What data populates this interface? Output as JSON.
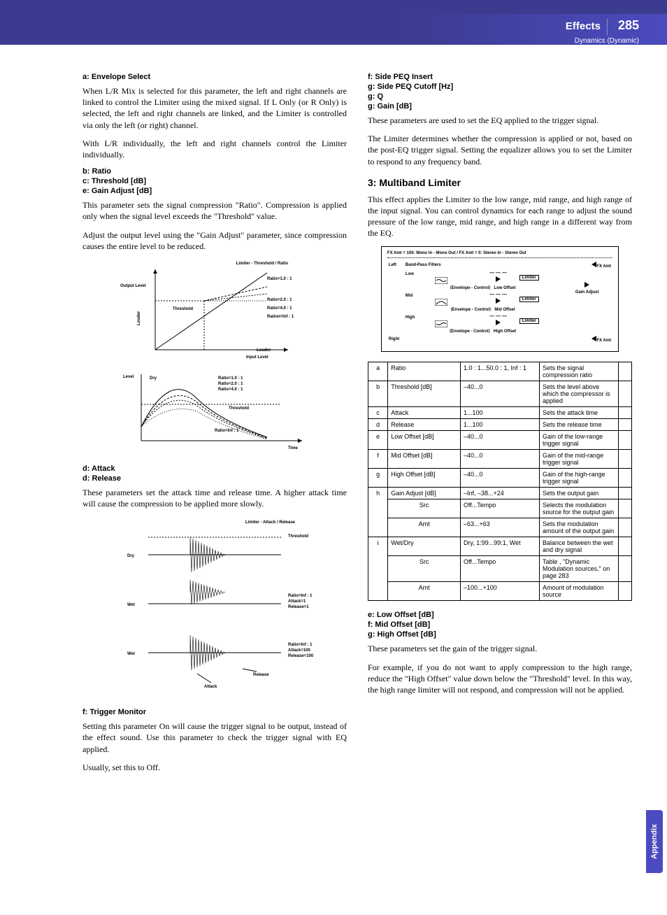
{
  "header": {
    "title": "Effects",
    "page": "285",
    "subtitle": "Dynamics (Dynamic)"
  },
  "sidetab": "Appendix",
  "left": {
    "a_env_sel": "a: Envelope Select",
    "a_p1": "When L/R Mix is selected for this parameter, the left and right channels are linked to control the Limiter using the mixed signal. If L Only (or R Only) is selected, the left and right channels are linked, and the Limiter is controlled via only the left (or right) channel.",
    "a_p2": "With L/R individually, the left and right channels control the Limiter individually.",
    "b_ratio": "b: Ratio",
    "c_thresh": "c: Threshold [dB]",
    "e_gain": "e: Gain Adjust [dB]",
    "bce_p1": "This parameter sets the signal compression \"Ratio\". Compression is applied only when the signal level exceeds the \"Threshold\" value.",
    "bce_p2": "Adjust the output level using the \"Gain Adjust\" parameter, since compression causes the entire level to be reduced.",
    "d_attack": "d: Attack",
    "d_release": "d: Release",
    "d_p1": "These parameters set the attack time and release time. A higher attack time will cause the compression to be applied more slowly.",
    "f_trigger": "f: Trigger Monitor",
    "f_p1": "Setting this parameter On will cause the trigger signal to be output, instead of the effect sound. Use this parameter to check the trigger signal with EQ applied.",
    "f_p2": "Usually, set this to Off.",
    "d1_title": "Limiter - Threshold / Ratio",
    "d1_out": "Output Level",
    "d1_in": "Input Level",
    "d1_thr": "Threshold",
    "d1_louder": "Louder",
    "d1_r1": "Ratio=1.0 : 1",
    "d1_r2": "Ratio=2.0 : 1",
    "d1_r4": "Ratio=4.0 : 1",
    "d1_ri": "Ration=Inf : 1",
    "d1_level": "Level",
    "d1_dry": "Dry",
    "d1_time": "Time",
    "d1_wet1": "Ratio=1.0 : 1",
    "d1_wet2": "Ratio=2.0 : 1",
    "d1_wet4": "Ratio=4.0 : 1",
    "d1_weti": "Ratio=Inf : 1",
    "d1_thr2": "Threshold",
    "d2_title": "Limiter - Attack / Release",
    "d2_dry": "Dry",
    "d2_wet": "Wet",
    "d2_thr": "Threshold",
    "d2_l1a": "Ratio=Inf : 1",
    "d2_l1b": "Attack=1",
    "d2_l1c": "Release=1",
    "d2_l2a": "Ratio=Inf : 1",
    "d2_l2b": "Attack=100",
    "d2_l2c": "Release=100",
    "d2_rel": "Release",
    "d2_att": "Attack"
  },
  "right": {
    "f_side": "f: Side PEQ Insert",
    "g_side": "g: Side PEQ Cutoff [Hz]",
    "g_q": "g: Q",
    "g_gain": "g: Gain [dB]",
    "fg_p1": "These parameters are used to set the EQ applied to the trigger signal.",
    "fg_p2": "The Limiter determines whether the compression is applied or not, based on the post-EQ trigger signal. Setting the equalizer allows you to set the Limiter to respond to any frequency band.",
    "sec3": "3: Multiband Limiter",
    "sec3_p1": "This effect applies the Limiter to the low range, mid range, and high range of the input signal. You can control dynamics for each range to adjust the sound pressure of the low range, mid range, and high range in a different way from the EQ.",
    "diag_title": "FX Amt = 100: Mono In - Mono Out  /  FX Amt = 0: Stereo In - Stereo Out",
    "diag_left": "Left",
    "diag_right": "Right",
    "diag_bpf": "Band-Pass Filters",
    "diag_low": "Low",
    "diag_mid": "Mid",
    "diag_high": "High",
    "diag_lowoff": "Low Offset",
    "diag_midoff": "Mid Offset",
    "diag_highoff": "High Offset",
    "diag_lim": "Limiter",
    "diag_env": "Envelope - Control",
    "diag_gain": "Gain Adjust",
    "diag_fx": "FX Amt",
    "e_low": "e: Low Offset [dB]",
    "f_mid": "f: Mid Offset [dB]",
    "g_high": "g: High Offset [dB]",
    "efg_p1": "These parameters set the gain of the trigger signal.",
    "efg_p2": "For example, if you do not want to apply compression to the high range, reduce the \"High Offset\" value down below the \"Threshold\" level. In this way, the high range limiter will not respond, and compression will not be applied."
  },
  "table": {
    "rows": [
      {
        "k": "a",
        "name": "Ratio",
        "range": "1.0 : 1...50.0 : 1, Inf : 1",
        "desc": "Sets the signal compression ratio"
      },
      {
        "k": "b",
        "name": "Threshold [dB]",
        "range": "–40...0",
        "desc": "Sets the level above which the compressor is applied"
      },
      {
        "k": "c",
        "name": "Attack",
        "range": "1...100",
        "desc": "Sets the attack time"
      },
      {
        "k": "d",
        "name": "Release",
        "range": "1...100",
        "desc": "Sets the release time"
      },
      {
        "k": "e",
        "name": "Low Offset [dB]",
        "range": "–40...0",
        "desc": "Gain of the low-range trigger signal"
      },
      {
        "k": "f",
        "name": "Mid Offset [dB]",
        "range": "–40...0",
        "desc": "Gain of the mid-range trigger signal"
      },
      {
        "k": "g",
        "name": "High Offset [dB]",
        "range": "–40...0",
        "desc": "Gain of the high-range trigger signal"
      },
      {
        "k": "h",
        "name": "Gain Adjust [dB]",
        "range": "–Inf, –38...+24",
        "desc": "Sets the output gain"
      },
      {
        "k": "",
        "name": "Src",
        "range": "Off...Tempo",
        "desc": "Selects the modulation source for the output gain"
      },
      {
        "k": "",
        "name": "Amt",
        "range": "–63...+63",
        "desc": "Sets the modulation amount of the output gain"
      },
      {
        "k": "i",
        "name": "Wet/Dry",
        "range": "Dry, 1:99...99:1, Wet",
        "desc": "Balance between the wet and dry signal"
      },
      {
        "k": "",
        "name": "Src",
        "range": "Off...Tempo",
        "desc": "Table , \"Dynamic Modulation sources,\" on page 283"
      },
      {
        "k": "",
        "name": "Amt",
        "range": "–100...+100",
        "desc": "Amount of modulation source"
      }
    ]
  },
  "chart_data": [
    {
      "type": "line",
      "title": "Limiter - Threshold / Ratio",
      "xlabel": "Input Level",
      "ylabel": "Output Level",
      "annotations": [
        "Threshold",
        "Louder"
      ],
      "series": [
        {
          "name": "Ratio=1.0 : 1"
        },
        {
          "name": "Ratio=2.0 : 1"
        },
        {
          "name": "Ratio=4.0 : 1"
        },
        {
          "name": "Ration=Inf : 1"
        }
      ]
    },
    {
      "type": "line",
      "title": "Limiter - Threshold / Ratio (envelope)",
      "xlabel": "Time",
      "ylabel": "Level",
      "annotations": [
        "Dry",
        "Threshold"
      ],
      "series": [
        {
          "name": "Ratio=1.0 : 1"
        },
        {
          "name": "Ratio=2.0 : 1"
        },
        {
          "name": "Ratio=4.0 : 1"
        },
        {
          "name": "Ratio=Inf : 1"
        }
      ]
    },
    {
      "type": "line",
      "title": "Limiter - Attack / Release",
      "series": [
        {
          "name": "Dry"
        },
        {
          "name": "Wet",
          "annotations": [
            "Ratio=Inf : 1",
            "Attack=1",
            "Release=1"
          ]
        },
        {
          "name": "Wet",
          "annotations": [
            "Ratio=Inf : 1",
            "Attack=100",
            "Release=100",
            "Release",
            "Attack",
            "Threshold"
          ]
        }
      ]
    }
  ]
}
